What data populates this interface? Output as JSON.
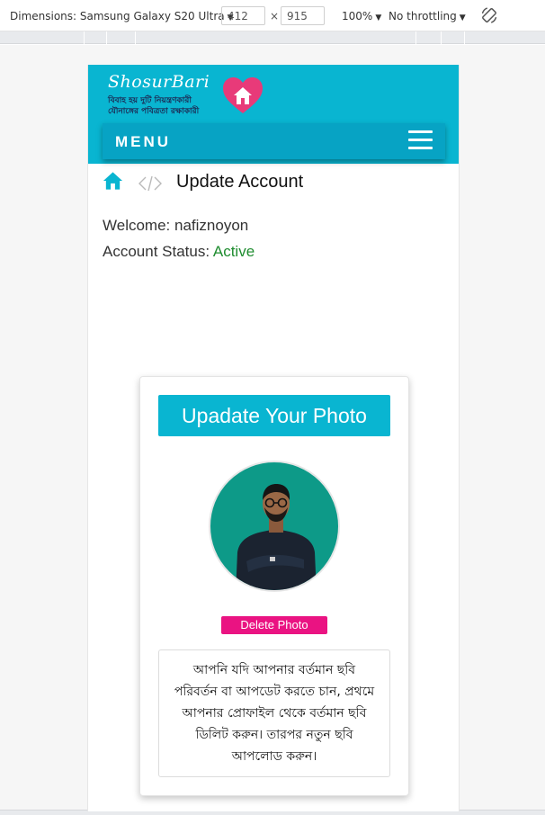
{
  "devtools": {
    "dimensions_label": "Dimensions: Samsung Galaxy S20 Ultra",
    "width": "412",
    "times": "×",
    "height": "915",
    "zoom": "100%",
    "throttling": "No throttling"
  },
  "site": {
    "logo_title": "ShosurBari",
    "logo_tagline_1": "বিবাহ হয় দুটি নিয়ন্ত্রণকারী",
    "logo_tagline_2": "যৌনাঙ্গের পবিত্রতা রক্ষাকারী",
    "menu_label": "MENU"
  },
  "breadcrumb": {
    "title": "Update Account"
  },
  "account": {
    "welcome_label": "Welcome:",
    "username": "nafiznoyon",
    "status_label": "Account Status:",
    "status_value": "Active"
  },
  "photo_card": {
    "heading": "Upadate Your Photo",
    "delete_label": "Delete Photo",
    "notice": "আপনি যদি আপনার বর্তমান ছবি পরিবর্তন বা আপডেট করতে চান, প্রথমে আপনার প্রোফাইল থেকে বর্তমান ছবি ডিলিট করুন। তারপর নতুন ছবি আপলোড করুন।"
  },
  "colors": {
    "brand": "#09b5d1",
    "menu_bar": "#07a3c4",
    "active_status": "#1e8c2f",
    "delete": "#ea1382",
    "photo_bg": "#0d9a88"
  },
  "icons": {
    "home": "home-icon",
    "separator": "code-brackets-icon",
    "menu": "hamburger-icon",
    "rotate": "rotate-icon",
    "logo": "heart-house-icon"
  }
}
